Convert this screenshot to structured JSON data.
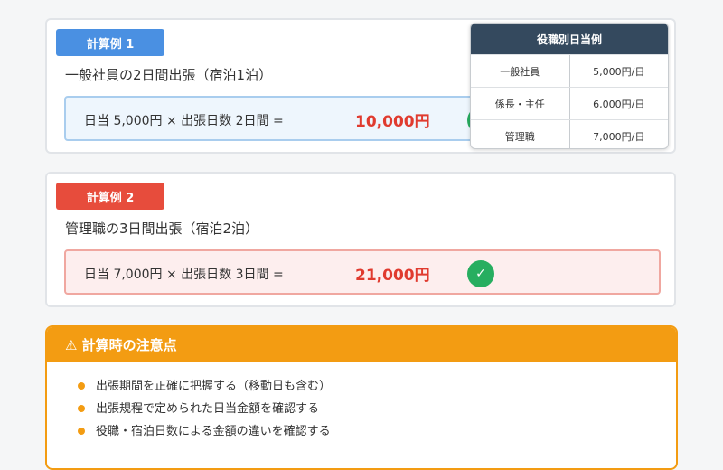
{
  "example1": {
    "badge": "計算例 1",
    "scenario": "一般社員の2日間出張（宿泊1泊）",
    "formula": "日当 5,000円 × 出張日数 2日間 =",
    "result": "10,000円",
    "check": "✓"
  },
  "example2": {
    "badge": "計算例 2",
    "scenario": "管理職の3日間出張（宿泊2泊）",
    "formula": "日当 7,000円 × 出張日数 3日間 =",
    "result": "21,000円",
    "check": "✓"
  },
  "rate_table": {
    "title": "役職別日当例",
    "rows": [
      {
        "role": "一般社員",
        "rate": "5,000円/日"
      },
      {
        "role": "係長・主任",
        "rate": "6,000円/日"
      },
      {
        "role": "管理職",
        "rate": "7,000円/日"
      }
    ]
  },
  "notes": {
    "title": "⚠ 計算時の注意点",
    "items": [
      "出張期間を正確に把握する（移動日も含む）",
      "出張規程で定められた日当金額を確認する",
      "役職・宿泊日数による金額の違いを確認する"
    ]
  },
  "colors": {
    "blue": "#4a90e2",
    "red": "#e74c3c",
    "orange": "#f39c12",
    "green": "#27ae60",
    "navy": "#34495e"
  }
}
